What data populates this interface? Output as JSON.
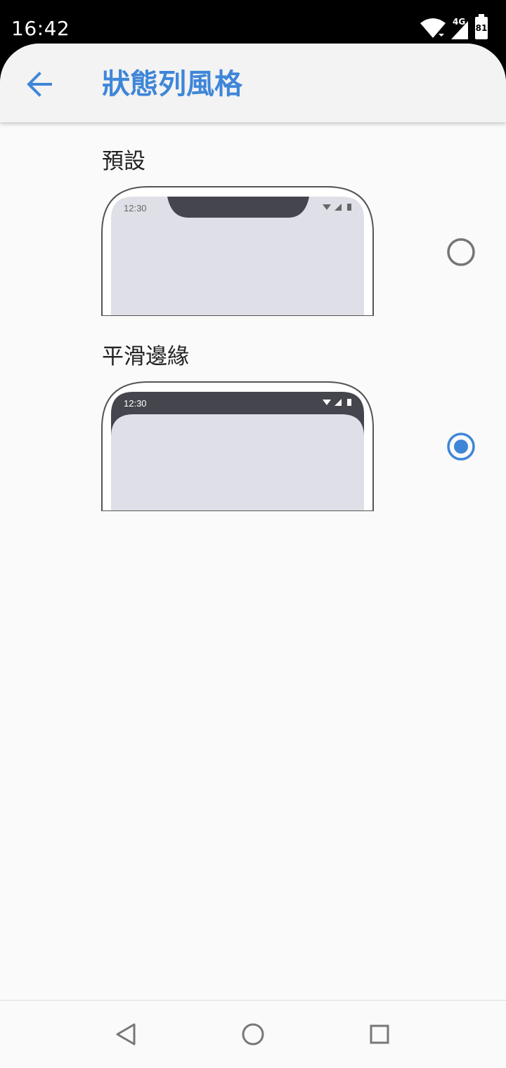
{
  "status_bar": {
    "time": "16:42",
    "network": "4G",
    "battery": "81",
    "icons": [
      "wifi-icon",
      "signal-icon",
      "battery-icon"
    ]
  },
  "app_bar": {
    "title": "狀態列風格",
    "back_icon": "arrow-left-icon"
  },
  "options": [
    {
      "label": "預設",
      "preview_time": "12:30",
      "selected": false
    },
    {
      "label": "平滑邊緣",
      "preview_time": "12:30",
      "selected": true
    }
  ],
  "nav_bar": {
    "icons": [
      "back-triangle-icon",
      "home-circle-icon",
      "recents-square-icon"
    ]
  },
  "colors": {
    "accent": "#3f86d8",
    "radio_off": "#757575",
    "preview_screen": "#dfe0e7",
    "preview_dark": "#45454d"
  }
}
